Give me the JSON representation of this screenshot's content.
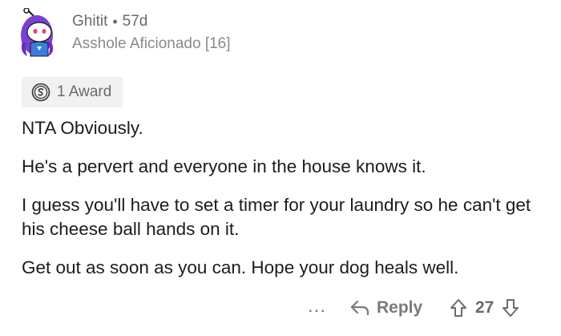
{
  "comment": {
    "username": "Ghitit",
    "separator": "•",
    "age": "57d",
    "flair": "Asshole Aficionado [16]",
    "award_label": "1 Award",
    "paragraphs": [
      "NTA Obviously.",
      "He's a pervert and everyone in the house knows it.",
      "I guess you'll have to set a timer for your laundry so he can't get his cheese ball hands on it.",
      "Get out as soon as you can. Hope your dog heals well."
    ]
  },
  "actions": {
    "more_label": "...",
    "reply_label": "Reply",
    "score": "27"
  },
  "icons": {
    "avatar": "snoo-avatar-icon",
    "award": "silver-award-icon",
    "more": "more-options-icon",
    "reply": "reply-arrow-icon",
    "upvote": "upvote-arrow-icon",
    "downvote": "downvote-arrow-icon"
  },
  "colors": {
    "meta_text": "#6b6b6b",
    "award_bg": "#f1f1f1",
    "body_text": "#1c1c1c",
    "avatar_purple": "#7b3fd1",
    "avatar_blue": "#3b7ddd"
  }
}
